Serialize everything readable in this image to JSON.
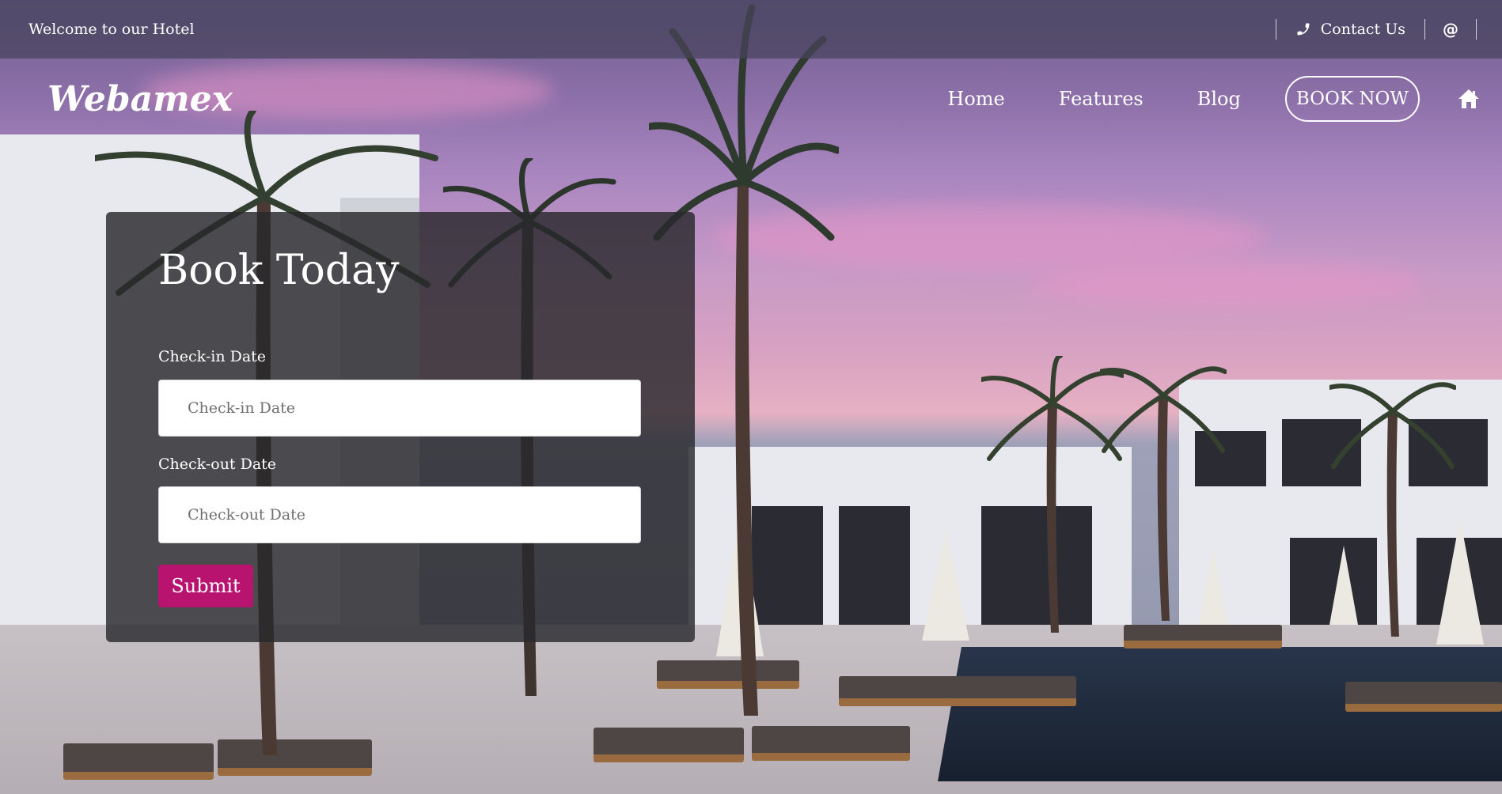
{
  "topbar": {
    "welcome": "Welcome to our Hotel",
    "contact_label": "Contact Us",
    "email_symbol": "@",
    "icons": {
      "contact": "phone-icon"
    }
  },
  "nav": {
    "logo": "Webamex",
    "items": [
      {
        "label": "Home"
      },
      {
        "label": "Features"
      },
      {
        "label": "Blog"
      }
    ],
    "cta": "BOOK NOW",
    "home_icon": "home-icon"
  },
  "booking": {
    "title": "Book Today",
    "checkin_label": "Check-in Date",
    "checkin_placeholder": "Check-in Date",
    "checkout_label": "Check-out Date",
    "checkout_placeholder": "Check-out Date",
    "submit": "Submit"
  },
  "colors": {
    "submit_bg": "#b8136e",
    "topbar_bg": "rgba(70,66,92,0.72)",
    "card_bg": "rgba(40,40,44,0.82)"
  }
}
